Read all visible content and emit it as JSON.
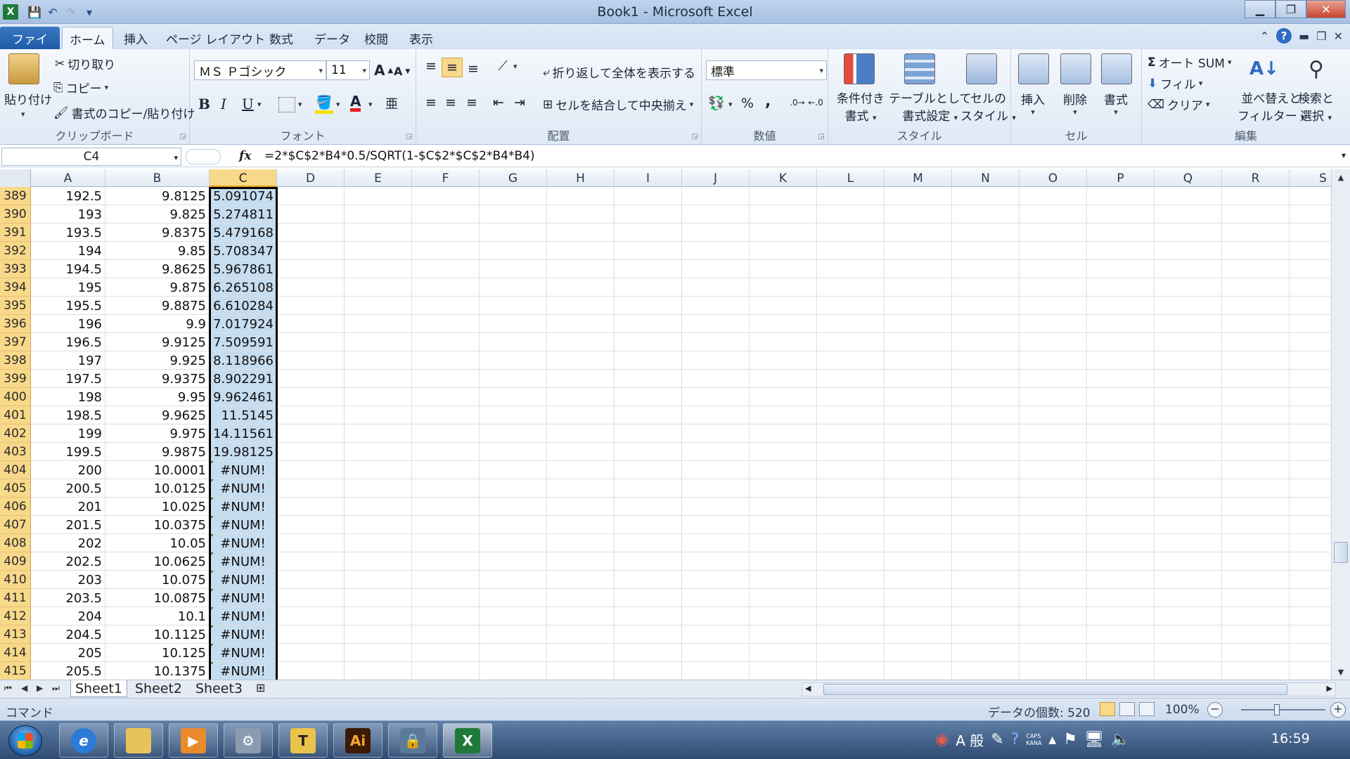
{
  "window": {
    "title": "Book1 - Microsoft Excel",
    "app_icon": "X",
    "min_label": "▁",
    "max_label": "❐",
    "close_label": "✕"
  },
  "qat": {
    "save_icon": "💾",
    "undo_icon": "↶",
    "redo_icon": "↷",
    "customize_icon": "▾"
  },
  "tabs": {
    "file": "ファイル",
    "items": [
      "ホーム",
      "挿入",
      "ページ レイアウト",
      "数式",
      "データ",
      "校閲",
      "表示"
    ],
    "active": "ホーム"
  },
  "ribbon": {
    "clipboard": {
      "label": "クリップボード",
      "paste": "貼り付け",
      "cut": "切り取り",
      "copy": "コピー",
      "format_painter": "書式のコピー/貼り付け"
    },
    "font": {
      "label": "フォント",
      "font_name": "ＭＳ Ｐゴシック",
      "font_size": "11",
      "grow": "A",
      "shrink": "A",
      "bold": "B",
      "italic": "I",
      "underline": "U",
      "font_color_letter": "A",
      "phonetic_letter": "亜"
    },
    "alignment": {
      "label": "配置",
      "wrap_text": "折り返して全体を表示する",
      "merge_center": "セルを結合して中央揃え"
    },
    "number": {
      "label": "数値",
      "format": "標準",
      "percent": "%",
      "comma": ","
    },
    "styles": {
      "label": "スタイル",
      "conditional_1": "条件付き",
      "conditional_2": "書式",
      "table_1": "テーブルとして",
      "table_2": "書式設定",
      "cell_1": "セルの",
      "cell_2": "スタイル"
    },
    "cells": {
      "label": "セル",
      "insert": "挿入",
      "delete": "削除",
      "format": "書式"
    },
    "editing": {
      "label": "編集",
      "autosum": "オート SUM",
      "fill": "フィル",
      "clear": "クリア",
      "sort_1": "並べ替えと",
      "sort_2": "フィルター",
      "find_1": "検索と",
      "find_2": "選択"
    }
  },
  "formula_bar": {
    "name_box": "C4",
    "fx": "fx",
    "formula": "=2*$C$2*B4*0.5/SQRT(1-$C$2*$C$2*B4*B4)"
  },
  "columns": [
    "A",
    "B",
    "C",
    "D",
    "E",
    "F",
    "G",
    "H",
    "I",
    "J",
    "K",
    "L",
    "M",
    "N",
    "O",
    "P",
    "Q",
    "R",
    "S"
  ],
  "rows": [
    {
      "n": "389",
      "a": "192.5",
      "b": "9.8125",
      "c": "5.091074"
    },
    {
      "n": "390",
      "a": "193",
      "b": "9.825",
      "c": "5.274811"
    },
    {
      "n": "391",
      "a": "193.5",
      "b": "9.8375",
      "c": "5.479168"
    },
    {
      "n": "392",
      "a": "194",
      "b": "9.85",
      "c": "5.708347"
    },
    {
      "n": "393",
      "a": "194.5",
      "b": "9.8625",
      "c": "5.967861"
    },
    {
      "n": "394",
      "a": "195",
      "b": "9.875",
      "c": "6.265108"
    },
    {
      "n": "395",
      "a": "195.5",
      "b": "9.8875",
      "c": "6.610284"
    },
    {
      "n": "396",
      "a": "196",
      "b": "9.9",
      "c": "7.017924"
    },
    {
      "n": "397",
      "a": "196.5",
      "b": "9.9125",
      "c": "7.509591"
    },
    {
      "n": "398",
      "a": "197",
      "b": "9.925",
      "c": "8.118966"
    },
    {
      "n": "399",
      "a": "197.5",
      "b": "9.9375",
      "c": "8.902291"
    },
    {
      "n": "400",
      "a": "198",
      "b": "9.95",
      "c": "9.962461"
    },
    {
      "n": "401",
      "a": "198.5",
      "b": "9.9625",
      "c": "11.5145"
    },
    {
      "n": "402",
      "a": "199",
      "b": "9.975",
      "c": "14.11561"
    },
    {
      "n": "403",
      "a": "199.5",
      "b": "9.9875",
      "c": "19.98125"
    },
    {
      "n": "404",
      "a": "200",
      "b": "10.0001",
      "c": "#NUM!"
    },
    {
      "n": "405",
      "a": "200.5",
      "b": "10.0125",
      "c": "#NUM!"
    },
    {
      "n": "406",
      "a": "201",
      "b": "10.025",
      "c": "#NUM!"
    },
    {
      "n": "407",
      "a": "201.5",
      "b": "10.0375",
      "c": "#NUM!"
    },
    {
      "n": "408",
      "a": "202",
      "b": "10.05",
      "c": "#NUM!"
    },
    {
      "n": "409",
      "a": "202.5",
      "b": "10.0625",
      "c": "#NUM!"
    },
    {
      "n": "410",
      "a": "203",
      "b": "10.075",
      "c": "#NUM!"
    },
    {
      "n": "411",
      "a": "203.5",
      "b": "10.0875",
      "c": "#NUM!"
    },
    {
      "n": "412",
      "a": "204",
      "b": "10.1",
      "c": "#NUM!"
    },
    {
      "n": "413",
      "a": "204.5",
      "b": "10.1125",
      "c": "#NUM!"
    },
    {
      "n": "414",
      "a": "205",
      "b": "10.125",
      "c": "#NUM!"
    },
    {
      "n": "415",
      "a": "205.5",
      "b": "10.1375",
      "c": "#NUM!"
    }
  ],
  "sheets": {
    "tabs": [
      "Sheet1",
      "Sheet2",
      "Sheet3"
    ],
    "active": "Sheet1"
  },
  "status": {
    "mode": "コマンド",
    "count": "データの個数: 520",
    "zoom": "100%"
  },
  "taskbar": {
    "ime_label": "A 般",
    "caps": "CAPS",
    "kana": "KANA",
    "clock": "16:59",
    "illustrator_label": "Ai",
    "excel_label": "X",
    "text_label": "T"
  }
}
